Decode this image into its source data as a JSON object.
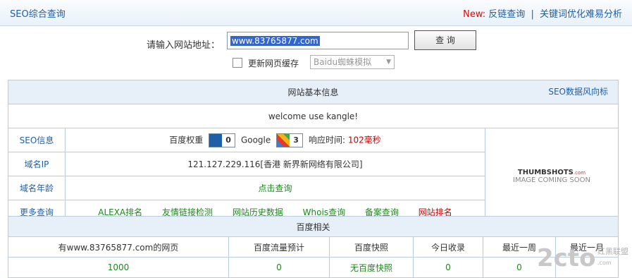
{
  "header": {
    "title": "SEO综合查询",
    "new_label": "New:",
    "link1": "反链查询",
    "separator": "|",
    "link2": "关键词优化难易分析"
  },
  "search": {
    "label": "请输入网站地址：",
    "url_value": "www.83765877.com",
    "button_label": "查 询",
    "checkbox_label": "更新网页缓存",
    "select_value": "Baidu蜘蛛模拟"
  },
  "basic_info": {
    "title": "网站基本信息",
    "trend_link": "SEO数据风向标",
    "welcome": "welcome use kangle!",
    "seo_label": "SEO信息",
    "baidu_label": "百度权重",
    "baidu_rank": "0",
    "google_label": "Google",
    "google_rank": "3",
    "response_label": "响应时间:",
    "response_value": "102毫秒",
    "ip_label": "域名IP",
    "ip_value": "121.127.229.116[香港 新界新网络有限公司]",
    "age_label": "域名年龄",
    "age_value": "点击查询",
    "more_label": "更多查询",
    "more_links": [
      "ALEXA排名",
      "友情链接检测",
      "网站历史数据",
      "Whois查询",
      "备案查询",
      "网站排名"
    ],
    "thumbshots_logo": "THUMBSHOTS",
    "thumbshots_com": ".com",
    "thumbshots_sub": "IMAGE COMING SOON"
  },
  "baidu": {
    "title": "百度相关",
    "columns": [
      "有www.83765877.com的网页",
      "百度流量预计",
      "百度快照",
      "今日收录",
      "最近一周",
      "最近一月"
    ],
    "values": [
      "1000",
      "0",
      "无百度快照",
      "0",
      "0",
      ""
    ]
  },
  "watermark": {
    "main": "2cto",
    "side": "红黑联盟",
    "side_sub": ".com"
  },
  "colors": {
    "link": "#1f5fa8",
    "accent_red": "#cc0000",
    "value_green": "#1a8a1a",
    "header_bg": "#e7eff8",
    "border": "#b8cde2"
  }
}
